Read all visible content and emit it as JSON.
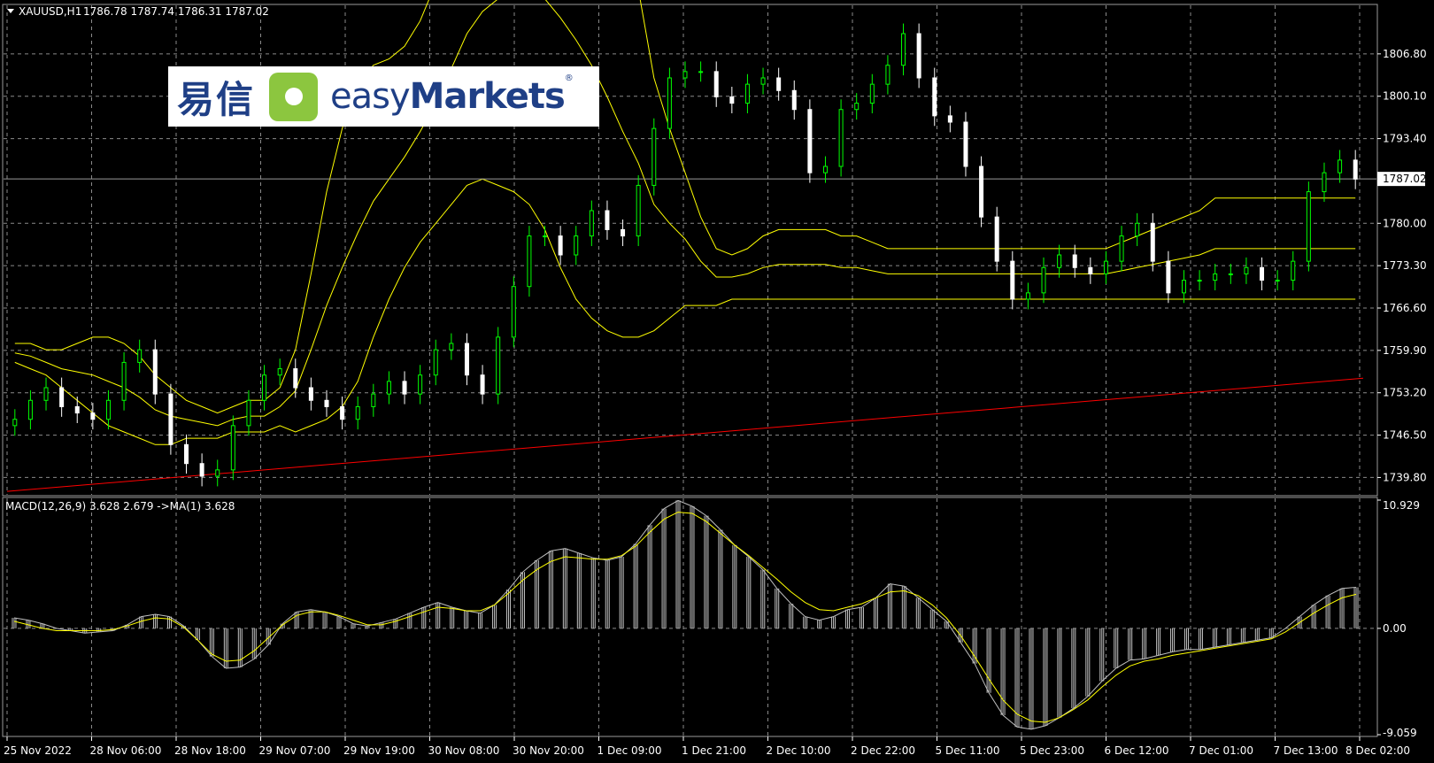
{
  "header": {
    "symbol": "XAUUSD,H1",
    "ohlc": "1786.78 1787.74 1786.31 1787.02"
  },
  "logo": {
    "cn_text": "易信",
    "en_light": "easy",
    "en_bold": "Markets",
    "reg": "®"
  },
  "colors": {
    "background": "#000000",
    "grid": "#8a8a8a",
    "bull_candle": "#00ff00",
    "bear_candle": "#ffffff",
    "bands": "#ffff00",
    "trendline": "#ff0000",
    "macd_hist": "#c0c0c0",
    "macd_signal": "#ffff00",
    "price_line": "#9a9a9a"
  },
  "chart_data": [
    {
      "type": "candlestick",
      "title": "XAUUSD,H1",
      "indicators": [
        "Bollinger Bands (outer)",
        "Bollinger Bands (inner)",
        "Trendline"
      ],
      "price_ticks": [
        "1806.80",
        "1800.10",
        "1793.40",
        "1787.02",
        "1780.00",
        "1773.30",
        "1766.60",
        "1759.90",
        "1753.20",
        "1746.50",
        "1739.80"
      ],
      "current_price": "1787.02",
      "ylim": [
        1737.2,
        1814.2
      ],
      "closes": [
        1749,
        1752,
        1754,
        1751,
        1750,
        1749,
        1752,
        1758,
        1760,
        1753,
        1745,
        1742,
        1740,
        1741,
        1748,
        1752,
        1756,
        1757,
        1754,
        1752,
        1751,
        1749,
        1751,
        1753,
        1755,
        1753,
        1756,
        1760,
        1761,
        1756,
        1753,
        1762,
        1770,
        1778,
        1778,
        1775,
        1778,
        1782,
        1779,
        1778,
        1786,
        1795,
        1803,
        1804,
        1804,
        1800,
        1799,
        1802,
        1803,
        1801,
        1798,
        1788,
        1789,
        1798,
        1799,
        1802,
        1805,
        1810,
        1803,
        1797,
        1796,
        1789,
        1781,
        1774,
        1768,
        1769,
        1773,
        1775,
        1773,
        1772,
        1774,
        1778,
        1780,
        1774,
        1769,
        1771,
        1771,
        1772,
        1772,
        1773,
        1771,
        1771,
        1774,
        1785,
        1788,
        1790,
        1787
      ],
      "upper_band": [
        1761,
        1761,
        1760,
        1760,
        1761,
        1762,
        1762,
        1761,
        1759,
        1756,
        1754,
        1752,
        1751,
        1750,
        1751,
        1752,
        1752,
        1754,
        1760,
        1772,
        1785,
        1795,
        1802,
        1805,
        1806,
        1808,
        1812,
        1818,
        1826,
        1834,
        1840,
        1845,
        1848,
        1850,
        1852,
        1852,
        1850,
        1845,
        1837,
        1827,
        1817,
        1803,
        1795,
        1788,
        1781,
        1776,
        1775,
        1776,
        1778,
        1779,
        1779,
        1779,
        1779,
        1778,
        1778,
        1777,
        1776,
        1776,
        1776,
        1776,
        1776,
        1776,
        1776,
        1776,
        1776,
        1776,
        1776,
        1776,
        1776,
        1776,
        1776,
        1777,
        1778,
        1779,
        1780,
        1781,
        1782,
        1784,
        1784,
        1784,
        1784,
        1784,
        1784,
        1784,
        1784,
        1784,
        1784
      ],
      "lower_band": [
        1758,
        1757,
        1756,
        1754,
        1752,
        1750,
        1748,
        1747,
        1746,
        1745,
        1745,
        1746,
        1746,
        1746,
        1747,
        1747,
        1747,
        1748,
        1747,
        1748,
        1749,
        1751,
        1755,
        1762,
        1768,
        1773,
        1777,
        1780,
        1783,
        1786,
        1787,
        1786,
        1785,
        1783,
        1779,
        1773,
        1768,
        1765,
        1763,
        1762,
        1762,
        1763,
        1765,
        1767,
        1767,
        1767,
        1768,
        1768,
        1768,
        1768,
        1768,
        1768,
        1768,
        1768,
        1768,
        1768,
        1768,
        1768,
        1768,
        1768,
        1768,
        1768,
        1768,
        1768,
        1768,
        1768,
        1768,
        1768,
        1768,
        1768,
        1768,
        1768,
        1768,
        1768,
        1768,
        1768,
        1768,
        1768,
        1768,
        1768,
        1768,
        1768,
        1768,
        1768,
        1768,
        1768,
        1768
      ]
    },
    {
      "type": "bar",
      "title": "MACD(12,26,9) 3.628 2.679  ->MA(1) 3.628",
      "value_ticks": [
        "10.929",
        "0.00",
        "-9.059"
      ],
      "ylim": [
        -9.059,
        10.929
      ],
      "histogram": [
        0.9,
        0.7,
        0.4,
        0.0,
        -0.2,
        -0.4,
        -0.3,
        -0.2,
        0.3,
        1.0,
        1.2,
        1.0,
        0.2,
        -1.0,
        -2.4,
        -3.4,
        -3.3,
        -2.6,
        -1.4,
        0.4,
        1.4,
        1.6,
        1.4,
        1.0,
        0.4,
        0.2,
        0.5,
        0.8,
        1.3,
        1.8,
        2.2,
        1.8,
        1.5,
        1.3,
        2.0,
        3.3,
        4.8,
        5.8,
        6.6,
        6.8,
        6.4,
        6.0,
        5.8,
        6.1,
        7.2,
        8.8,
        10.2,
        10.9,
        10.4,
        9.6,
        8.4,
        7.1,
        6.1,
        5.0,
        3.4,
        2.1,
        1.0,
        0.7,
        1.0,
        1.6,
        1.8,
        2.6,
        3.8,
        3.6,
        2.6,
        1.6,
        0.6,
        -1.2,
        -3.0,
        -5.5,
        -7.4,
        -8.4,
        -8.6,
        -8.3,
        -7.6,
        -6.8,
        -5.8,
        -4.5,
        -3.4,
        -2.7,
        -2.6,
        -2.3,
        -2.0,
        -1.8,
        -1.8,
        -1.6,
        -1.4,
        -1.2,
        -1.0,
        -0.8,
        0.0,
        1.0,
        2.0,
        2.8,
        3.4,
        3.5
      ],
      "signal": [
        0.6,
        0.3,
        0.0,
        -0.2,
        -0.2,
        -0.2,
        -0.2,
        -0.1,
        0.2,
        0.6,
        0.9,
        0.8,
        0.1,
        -1.0,
        -2.2,
        -2.8,
        -2.7,
        -1.9,
        -0.8,
        0.3,
        1.1,
        1.4,
        1.4,
        1.1,
        0.7,
        0.3,
        0.3,
        0.6,
        1.0,
        1.4,
        1.8,
        1.7,
        1.5,
        1.5,
        2.0,
        3.0,
        4.1,
        5.0,
        5.7,
        6.1,
        6.0,
        5.9,
        5.9,
        6.2,
        7.0,
        8.2,
        9.3,
        9.9,
        9.8,
        9.1,
        8.1,
        7.1,
        6.2,
        5.2,
        4.2,
        3.1,
        2.2,
        1.6,
        1.5,
        1.8,
        2.1,
        2.6,
        3.1,
        3.2,
        2.8,
        2.0,
        0.9,
        -0.6,
        -2.4,
        -4.3,
        -6.1,
        -7.3,
        -7.9,
        -8.0,
        -7.6,
        -6.9,
        -6.1,
        -5.0,
        -4.0,
        -3.2,
        -2.8,
        -2.6,
        -2.3,
        -2.1,
        -1.9,
        -1.7,
        -1.5,
        -1.3,
        -1.1,
        -0.9,
        -0.3,
        0.5,
        1.3,
        2.0,
        2.6,
        2.9
      ]
    }
  ],
  "time_axis": {
    "labels": [
      "25 Nov 2022",
      "28 Nov 06:00",
      "28 Nov 18:00",
      "29 Nov 07:00",
      "29 Nov 19:00",
      "30 Nov 08:00",
      "30 Nov 20:00",
      "1 Dec 09:00",
      "1 Dec 21:00",
      "2 Dec 10:00",
      "2 Dec 22:00",
      "5 Dec 11:00",
      "5 Dec 23:00",
      "6 Dec 12:00",
      "7 Dec 01:00",
      "7 Dec 13:00",
      "8 Dec 02:00"
    ]
  }
}
